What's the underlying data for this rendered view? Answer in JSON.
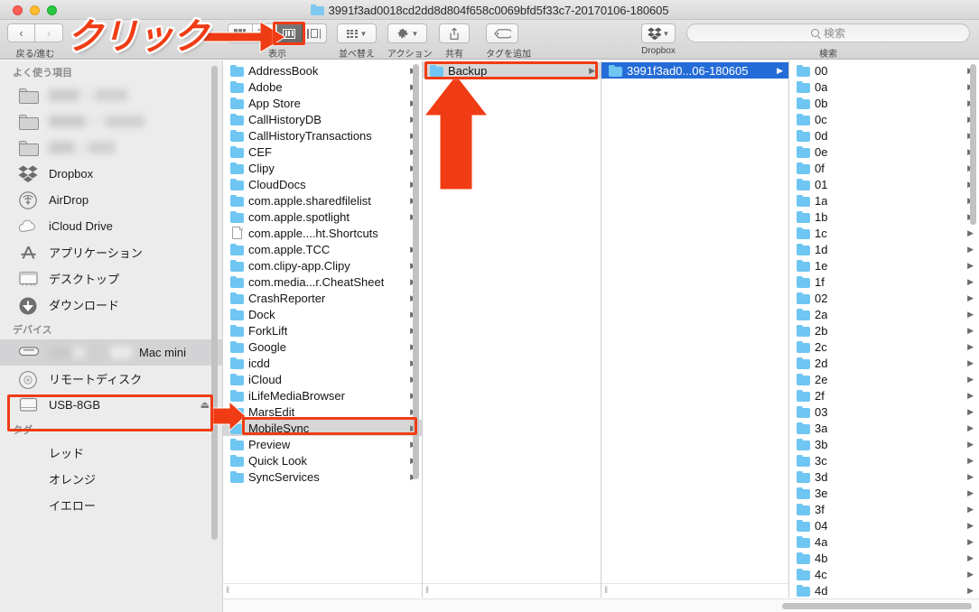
{
  "window": {
    "title": "3991f3ad0018cd2dd8d804f658c0069bfd5f33c7-20170106-180605",
    "traffic_lights": [
      "close",
      "minimize",
      "zoom"
    ]
  },
  "toolbar": {
    "nav_label": "戻る/進む",
    "back_icon": "chevron-left-icon",
    "forward_icon": "chevron-right-icon",
    "view_label": "表示",
    "view_options": [
      "icon-view",
      "list-view",
      "column-view",
      "cover-flow-view"
    ],
    "view_selected": "column-view",
    "arrange_label": "並べ替え",
    "action_label": "アクション",
    "share_label": "共有",
    "tag_label": "タグを追加",
    "dropbox_label": "Dropbox",
    "search_label": "検索",
    "search_placeholder": "検索",
    "search_value": ""
  },
  "sidebar": {
    "sections": [
      {
        "header": "よく使う項目",
        "items": [
          {
            "label": "",
            "icon": "folder-icon",
            "redacted": true
          },
          {
            "label": "",
            "icon": "folder-icon",
            "redacted": true
          },
          {
            "label": "",
            "icon": "folder-icon",
            "redacted": true
          },
          {
            "label": "Dropbox",
            "icon": "dropbox-icon",
            "redacted": false
          },
          {
            "label": "AirDrop",
            "icon": "airdrop-icon",
            "redacted": false
          },
          {
            "label": "iCloud Drive",
            "icon": "cloud-icon",
            "redacted": false
          },
          {
            "label": "アプリケーション",
            "icon": "app-store-icon",
            "redacted": false
          },
          {
            "label": "デスクトップ",
            "icon": "desktop-icon",
            "redacted": false
          },
          {
            "label": "ダウンロード",
            "icon": "download-icon",
            "redacted": false
          }
        ]
      },
      {
        "header": "デバイス",
        "items": [
          {
            "label": "Mac mini",
            "icon": "hard-drive-icon",
            "redacted": true,
            "selected": true,
            "highlighted": true
          },
          {
            "label": "リモートディスク",
            "icon": "optical-disc-icon",
            "redacted": false
          },
          {
            "label": "USB-8GB",
            "icon": "external-drive-icon",
            "redacted": false,
            "eject": "⏏"
          }
        ]
      },
      {
        "header": "タグ",
        "items": [
          {
            "label": "レッド",
            "icon": "tag-dot-icon",
            "color": "#f75b5b"
          },
          {
            "label": "オレンジ",
            "icon": "tag-dot-icon",
            "color": "#f5a124"
          },
          {
            "label": "イエロー",
            "icon": "tag-dot-icon",
            "color": "#f7d117"
          }
        ]
      }
    ]
  },
  "columns": [
    {
      "name": "column-1-library",
      "items": [
        {
          "label": "AddressBook",
          "type": "folder",
          "arrow": "▶"
        },
        {
          "label": "Adobe",
          "type": "folder",
          "arrow": "▶"
        },
        {
          "label": "App Store",
          "type": "folder",
          "arrow": "▶"
        },
        {
          "label": "CallHistoryDB",
          "type": "folder",
          "arrow": "▶"
        },
        {
          "label": "CallHistoryTransactions",
          "type": "folder",
          "arrow": "▶"
        },
        {
          "label": "CEF",
          "type": "folder",
          "arrow": "▶"
        },
        {
          "label": "Clipy",
          "type": "folder",
          "arrow": "▶"
        },
        {
          "label": "CloudDocs",
          "type": "folder",
          "arrow": "▶"
        },
        {
          "label": "com.apple.sharedfilelist",
          "type": "folder",
          "arrow": "▶"
        },
        {
          "label": "com.apple.spotlight",
          "type": "folder",
          "arrow": "▶"
        },
        {
          "label": "com.apple....ht.Shortcuts",
          "type": "file",
          "arrow": ""
        },
        {
          "label": "com.apple.TCC",
          "type": "folder",
          "arrow": "▶"
        },
        {
          "label": "com.clipy-app.Clipy",
          "type": "folder",
          "arrow": "▶"
        },
        {
          "label": "com.media...r.CheatSheet",
          "type": "folder",
          "arrow": "▶"
        },
        {
          "label": "CrashReporter",
          "type": "folder",
          "arrow": "▶"
        },
        {
          "label": "Dock",
          "type": "folder",
          "arrow": "▶"
        },
        {
          "label": "ForkLift",
          "type": "folder",
          "arrow": "▶"
        },
        {
          "label": "Google",
          "type": "folder",
          "arrow": "▶"
        },
        {
          "label": "icdd",
          "type": "folder",
          "arrow": "▶"
        },
        {
          "label": "iCloud",
          "type": "folder",
          "arrow": "▶"
        },
        {
          "label": "iLifeMediaBrowser",
          "type": "folder",
          "arrow": "▶"
        },
        {
          "label": "MarsEdit",
          "type": "folder",
          "arrow": "▶"
        },
        {
          "label": "MobileSync",
          "type": "folder",
          "arrow": "▶",
          "selection": "gray"
        },
        {
          "label": "Preview",
          "type": "folder",
          "arrow": "▶"
        },
        {
          "label": "Quick Look",
          "type": "folder",
          "arrow": "▶"
        },
        {
          "label": "SyncServices",
          "type": "folder",
          "arrow": "▶"
        }
      ]
    },
    {
      "name": "column-2-mobilesync",
      "items": [
        {
          "label": "Backup",
          "type": "folder",
          "arrow": "▶",
          "selection": "gray"
        }
      ]
    },
    {
      "name": "column-3-backup",
      "items": [
        {
          "label": "3991f3ad0...06-180605",
          "type": "folder",
          "arrow": "▶",
          "selection": "blue"
        }
      ]
    },
    {
      "name": "column-4-backup-contents",
      "items": [
        {
          "label": "00",
          "type": "folder",
          "arrow": "▶"
        },
        {
          "label": "0a",
          "type": "folder",
          "arrow": "▶"
        },
        {
          "label": "0b",
          "type": "folder",
          "arrow": "▶"
        },
        {
          "label": "0c",
          "type": "folder",
          "arrow": "▶"
        },
        {
          "label": "0d",
          "type": "folder",
          "arrow": "▶"
        },
        {
          "label": "0e",
          "type": "folder",
          "arrow": "▶"
        },
        {
          "label": "0f",
          "type": "folder",
          "arrow": "▶"
        },
        {
          "label": "01",
          "type": "folder",
          "arrow": "▶"
        },
        {
          "label": "1a",
          "type": "folder",
          "arrow": "▶"
        },
        {
          "label": "1b",
          "type": "folder",
          "arrow": "▶"
        },
        {
          "label": "1c",
          "type": "folder",
          "arrow": "▶"
        },
        {
          "label": "1d",
          "type": "folder",
          "arrow": "▶"
        },
        {
          "label": "1e",
          "type": "folder",
          "arrow": "▶"
        },
        {
          "label": "1f",
          "type": "folder",
          "arrow": "▶"
        },
        {
          "label": "02",
          "type": "folder",
          "arrow": "▶"
        },
        {
          "label": "2a",
          "type": "folder",
          "arrow": "▶"
        },
        {
          "label": "2b",
          "type": "folder",
          "arrow": "▶"
        },
        {
          "label": "2c",
          "type": "folder",
          "arrow": "▶"
        },
        {
          "label": "2d",
          "type": "folder",
          "arrow": "▶"
        },
        {
          "label": "2e",
          "type": "folder",
          "arrow": "▶"
        },
        {
          "label": "2f",
          "type": "folder",
          "arrow": "▶"
        },
        {
          "label": "03",
          "type": "folder",
          "arrow": "▶"
        },
        {
          "label": "3a",
          "type": "folder",
          "arrow": "▶"
        },
        {
          "label": "3b",
          "type": "folder",
          "arrow": "▶"
        },
        {
          "label": "3c",
          "type": "folder",
          "arrow": "▶"
        },
        {
          "label": "3d",
          "type": "folder",
          "arrow": "▶"
        },
        {
          "label": "3e",
          "type": "folder",
          "arrow": "▶"
        },
        {
          "label": "3f",
          "type": "folder",
          "arrow": "▶"
        },
        {
          "label": "04",
          "type": "folder",
          "arrow": "▶"
        },
        {
          "label": "4a",
          "type": "folder",
          "arrow": "▶"
        },
        {
          "label": "4b",
          "type": "folder",
          "arrow": "▶"
        },
        {
          "label": "4c",
          "type": "folder",
          "arrow": "▶"
        },
        {
          "label": "4d",
          "type": "folder",
          "arrow": "▶"
        }
      ]
    }
  ],
  "annotations": {
    "click_text": "クリック",
    "accent_color": "#f03c14",
    "arrows": [
      "arrow-to-column-view-button",
      "arrow-to-mac-mini",
      "arrow-to-backup"
    ],
    "highlight_boxes": [
      "column-view-button",
      "mac-mini-sidebar-item",
      "mobilesync-row",
      "backup-row"
    ]
  }
}
